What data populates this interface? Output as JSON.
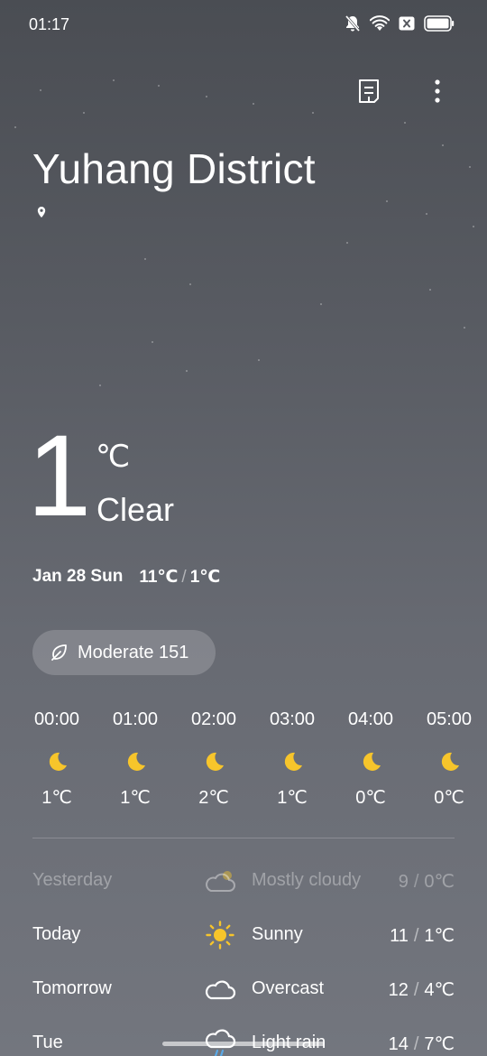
{
  "status_bar": {
    "time": "01:17",
    "icons": [
      "bell-off-icon",
      "wifi-icon",
      "sim-x-icon",
      "battery-icon"
    ]
  },
  "top_actions": {
    "icons": [
      "document-icon",
      "more-vert-icon"
    ]
  },
  "location": {
    "name": "Yuhang District",
    "pin_icon": "location-pin-icon"
  },
  "current": {
    "temperature": "1",
    "unit": "℃",
    "condition": "Clear",
    "date": "Jan 28 Sun",
    "high": "11℃",
    "low": "1℃",
    "range_separator": "/"
  },
  "air_quality": {
    "icon": "leaf-icon",
    "label": "Moderate 151"
  },
  "hourly": [
    {
      "time": "00:00",
      "icon": "moon-icon",
      "temp": "1℃"
    },
    {
      "time": "01:00",
      "icon": "moon-icon",
      "temp": "1℃"
    },
    {
      "time": "02:00",
      "icon": "moon-icon",
      "temp": "2℃"
    },
    {
      "time": "03:00",
      "icon": "moon-icon",
      "temp": "1℃"
    },
    {
      "time": "04:00",
      "icon": "moon-icon",
      "temp": "0℃"
    },
    {
      "time": "05:00",
      "icon": "moon-icon",
      "temp": "0℃"
    }
  ],
  "daily": [
    {
      "day": "Yesterday",
      "icon": "partly-cloudy-icon",
      "condition": "Mostly cloudy",
      "high": "9",
      "low": "0℃",
      "past": true
    },
    {
      "day": "Today",
      "icon": "sun-icon",
      "condition": "Sunny",
      "high": "11",
      "low": "1℃",
      "past": false
    },
    {
      "day": "Tomorrow",
      "icon": "cloud-icon",
      "condition": "Overcast",
      "high": "12",
      "low": "4℃",
      "past": false
    },
    {
      "day": "Tue",
      "icon": "rain-icon",
      "condition": "Light rain",
      "high": "14",
      "low": "7℃",
      "past": false
    }
  ],
  "colors": {
    "moon": "#f7c52b",
    "sun": "#f7c52b",
    "rain": "#5aa9e6"
  }
}
